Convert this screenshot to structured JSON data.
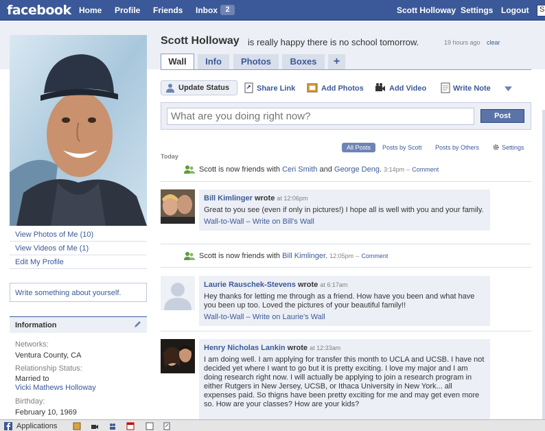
{
  "nav": {
    "logo": "facebook",
    "home": "Home",
    "profile": "Profile",
    "friends": "Friends",
    "inbox": "Inbox",
    "inbox_count": "2",
    "user": "Scott Holloway",
    "settings": "Settings",
    "logout": "Logout",
    "search_value": "S"
  },
  "profile": {
    "name": "Scott Holloway",
    "status": "is really happy there is no school tomorrow.",
    "status_time": "19 hours ago",
    "clear": "clear"
  },
  "left": {
    "links": [
      "View Photos of Me (10)",
      "View Videos of Me (1)",
      "Edit My Profile"
    ],
    "write_something": "Write something about yourself.",
    "info_title": "Information",
    "networks_label": "Networks:",
    "networks_value": "Ventura County, CA",
    "relationship_label": "Relationship Status:",
    "relationship_value": "Married to",
    "relationship_link": "Vicki Mathews Holloway",
    "birthday_label": "Birthday:",
    "birthday_value": "February 10, 1969"
  },
  "tabs": [
    "Wall",
    "Info",
    "Photos",
    "Boxes",
    "+"
  ],
  "publisher": {
    "update_status": "Update Status",
    "share_link": "Share Link",
    "add_photos": "Add Photos",
    "add_video": "Add Video",
    "write_note": "Write Note",
    "placeholder": "What are you doing right now?",
    "post": "Post"
  },
  "filters": {
    "all": "All Posts",
    "by_scott": "Posts by Scott",
    "by_others": "Posts by Others",
    "settings": "Settings"
  },
  "feed": {
    "today": "Today",
    "story1": {
      "text": "Scott is now friends with",
      "friend1": "Ceri Smith",
      "and": "and",
      "friend2": "George Deng",
      "time": "3:14pm",
      "comment": "Comment"
    },
    "story2": {
      "text": "Scott is now friends with",
      "friend": "Bill Kimlinger",
      "time": "12:05pm",
      "comment": "Comment"
    }
  },
  "posts": [
    {
      "author": "Bill Kimlinger",
      "wrote": "wrote",
      "time": "at 12:06pm",
      "body": "Great to you see (even if only in pictures!) I hope all is well with you and your family.",
      "link1": "Wall-to-Wall",
      "link2": "Write on Bill's Wall"
    },
    {
      "author": "Laurie Rauschek-Stevens",
      "wrote": "wrote",
      "time": "at 6:17am",
      "body": "Hey thanks for letting me through as a friend. How have you been and what have you been up too. Loved the pictures of your beautiful family!!",
      "link1": "Wall-to-Wall",
      "link2": "Write on Laurie's Wall"
    },
    {
      "author": "Henry Nicholas Lankin",
      "wrote": "wrote",
      "time": "at 12:33am",
      "body": "I am doing well. I am applying for transfer this month to UCLA and UCSB. I have not decided yet where I want to go but it is pretty exciting. I love my major and I am doing research right now. I will actually be applying to join a research program in either Rutgers in New Jersey, UCSB, or Ithaca University in New York... all expenses paid. So thigns have been pretty exciting for me and may get even more so. How are your classes? How are your kids?"
    }
  ],
  "bottom": {
    "applications": "Applications"
  },
  "colors": {
    "brand": "#3b5998",
    "light": "#eceff5",
    "border": "#d8dfea"
  }
}
